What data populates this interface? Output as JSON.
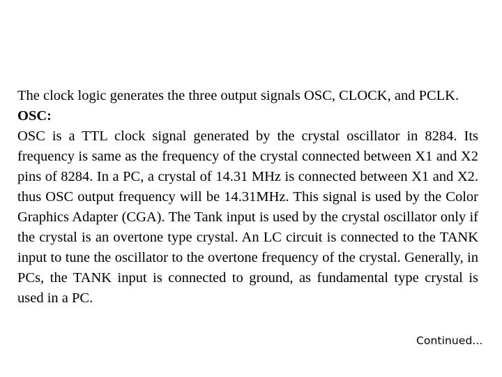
{
  "slide": {
    "background_color": "#ffffff",
    "text_color": "#000000",
    "paragraphs": {
      "intro": "The clock logic generates the three output signals OSC, CLOCK, and PCLK.",
      "heading": "OSC:",
      "detail": "OSC is a TTL clock signal generated by the crystal oscillator in 8284. Its frequency is same as the frequency of the crystal connected between X1 and X2 pins of 8284. In a PC, a crystal of 14.31 MHz is connected between X1 and X2. thus OSC output frequency will be 14.31MHz. This signal is used by the Color Graphics Adapter (CGA). The Tank input is used by the crystal oscillator only if the crystal is an overtone type crystal. An LC circuit is connected to the TANK input to tune the oscillator to the overtone frequency of the crystal. Generally, in PCs, the TANK input is connected to ground, as fundamental type crystal is used in a PC."
    },
    "footer": {
      "continued_label": "Continued..."
    }
  }
}
